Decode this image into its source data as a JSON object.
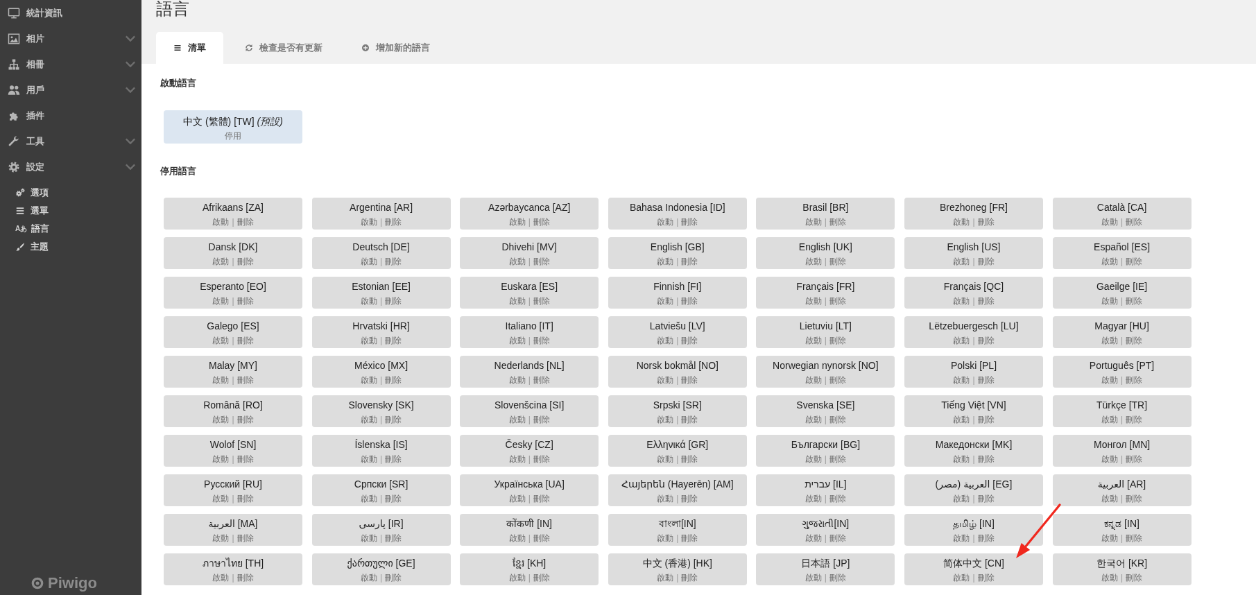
{
  "sidebar": {
    "items": [
      {
        "label": "統計資訊",
        "expandable": false
      },
      {
        "label": "相片",
        "expandable": true
      },
      {
        "label": "相冊",
        "expandable": true
      },
      {
        "label": "用戶",
        "expandable": true
      },
      {
        "label": "插件",
        "expandable": false
      },
      {
        "label": "工具",
        "expandable": true
      },
      {
        "label": "設定",
        "expandable": true,
        "children": [
          {
            "label": "選項"
          },
          {
            "label": "選單"
          },
          {
            "label": "語言",
            "glyph": "Aあ"
          },
          {
            "label": "主題"
          }
        ]
      }
    ],
    "logo": "Piwigo"
  },
  "page_title": "語言",
  "tabs": [
    {
      "label": "清單",
      "selected": true
    },
    {
      "label": "檢查是否有更新",
      "selected": false
    },
    {
      "label": "增加新的語言",
      "selected": false
    }
  ],
  "enabled_section": {
    "heading": "啟動語言",
    "languages": [
      {
        "name": "中文 (繁體) [TW] *(預設)*",
        "actions": [
          "停用"
        ]
      }
    ]
  },
  "disabled_section": {
    "heading": "停用語言",
    "languages": [
      {
        "name": "Afrikaans [ZA]",
        "actions": [
          "啟動",
          "刪除"
        ],
        "separator": "|"
      },
      {
        "name": "Argentina [AR]",
        "actions": [
          "啟動",
          "刪除"
        ],
        "separator": "|"
      },
      {
        "name": "Azərbaycanca [AZ]",
        "actions": [
          "啟動",
          "刪除"
        ],
        "separator": "|"
      },
      {
        "name": "Bahasa Indonesia [ID]",
        "actions": [
          "啟動",
          "刪除"
        ],
        "separator": "|"
      },
      {
        "name": "Brasil [BR]",
        "actions": [
          "啟動",
          "刪除"
        ],
        "separator": "|"
      },
      {
        "name": "Brezhoneg [FR]",
        "actions": [
          "啟動",
          "刪除"
        ],
        "separator": "|"
      },
      {
        "name": "Català [CA]",
        "actions": [
          "啟動",
          "刪除"
        ],
        "separator": "|"
      },
      {
        "name": "Dansk [DK]",
        "actions": [
          "啟動",
          "刪除"
        ],
        "separator": "|"
      },
      {
        "name": "Deutsch [DE]",
        "actions": [
          "啟動",
          "刪除"
        ],
        "separator": "|"
      },
      {
        "name": "Dhivehi [MV]",
        "actions": [
          "啟動",
          "刪除"
        ],
        "separator": "|"
      },
      {
        "name": "English [GB]",
        "actions": [
          "啟動",
          "刪除"
        ],
        "separator": "|"
      },
      {
        "name": "English [UK]",
        "actions": [
          "啟動",
          "刪除"
        ],
        "separator": "|"
      },
      {
        "name": "English [US]",
        "actions": [
          "啟動",
          "刪除"
        ],
        "separator": "|"
      },
      {
        "name": "Español [ES]",
        "actions": [
          "啟動",
          "刪除"
        ],
        "separator": "|"
      },
      {
        "name": "Esperanto [EO]",
        "actions": [
          "啟動",
          "刪除"
        ],
        "separator": "|"
      },
      {
        "name": "Estonian [EE]",
        "actions": [
          "啟動",
          "刪除"
        ],
        "separator": "|"
      },
      {
        "name": "Euskara [ES]",
        "actions": [
          "啟動",
          "刪除"
        ],
        "separator": "|"
      },
      {
        "name": "Finnish [FI]",
        "actions": [
          "啟動",
          "刪除"
        ],
        "separator": "|"
      },
      {
        "name": "Français [FR]",
        "actions": [
          "啟動",
          "刪除"
        ],
        "separator": "|"
      },
      {
        "name": "Français [QC]",
        "actions": [
          "啟動",
          "刪除"
        ],
        "separator": "|"
      },
      {
        "name": "Gaeilge [IE]",
        "actions": [
          "啟動",
          "刪除"
        ],
        "separator": "|"
      },
      {
        "name": "Galego [ES]",
        "actions": [
          "啟動",
          "刪除"
        ],
        "separator": "|"
      },
      {
        "name": "Hrvatski [HR]",
        "actions": [
          "啟動",
          "刪除"
        ],
        "separator": "|"
      },
      {
        "name": "Italiano [IT]",
        "actions": [
          "啟動",
          "刪除"
        ],
        "separator": "|"
      },
      {
        "name": "Latviešu [LV]",
        "actions": [
          "啟動",
          "刪除"
        ],
        "separator": "|"
      },
      {
        "name": "Lietuviu [LT]",
        "actions": [
          "啟動",
          "刪除"
        ],
        "separator": "|"
      },
      {
        "name": "Lëtzebuergesch [LU]",
        "actions": [
          "啟動",
          "刪除"
        ],
        "separator": "|"
      },
      {
        "name": "Magyar [HU]",
        "actions": [
          "啟動",
          "刪除"
        ],
        "separator": "|"
      },
      {
        "name": "Malay [MY]",
        "actions": [
          "啟動",
          "刪除"
        ],
        "separator": "|"
      },
      {
        "name": "México [MX]",
        "actions": [
          "啟動",
          "刪除"
        ],
        "separator": "|"
      },
      {
        "name": "Nederlands [NL]",
        "actions": [
          "啟動",
          "刪除"
        ],
        "separator": "|"
      },
      {
        "name": "Norsk bokmål [NO]",
        "actions": [
          "啟動",
          "刪除"
        ],
        "separator": "|"
      },
      {
        "name": "Norwegian nynorsk [NO]",
        "actions": [
          "啟動",
          "刪除"
        ],
        "separator": "|"
      },
      {
        "name": "Polski [PL]",
        "actions": [
          "啟動",
          "刪除"
        ],
        "separator": "|"
      },
      {
        "name": "Português [PT]",
        "actions": [
          "啟動",
          "刪除"
        ],
        "separator": "|"
      },
      {
        "name": "Română [RO]",
        "actions": [
          "啟動",
          "刪除"
        ],
        "separator": "|"
      },
      {
        "name": "Slovensky [SK]",
        "actions": [
          "啟動",
          "刪除"
        ],
        "separator": "|"
      },
      {
        "name": "Slovenšcina [SI]",
        "actions": [
          "啟動",
          "刪除"
        ],
        "separator": "|"
      },
      {
        "name": "Srpski [SR]",
        "actions": [
          "啟動",
          "刪除"
        ],
        "separator": "|"
      },
      {
        "name": "Svenska [SE]",
        "actions": [
          "啟動",
          "刪除"
        ],
        "separator": "|"
      },
      {
        "name": "Tiếng Việt [VN]",
        "actions": [
          "啟動",
          "刪除"
        ],
        "separator": "|"
      },
      {
        "name": "Türkçe [TR]",
        "actions": [
          "啟動",
          "刪除"
        ],
        "separator": "|"
      },
      {
        "name": "Wolof [SN]",
        "actions": [
          "啟動",
          "刪除"
        ],
        "separator": "|"
      },
      {
        "name": "Íslenska [IS]",
        "actions": [
          "啟動",
          "刪除"
        ],
        "separator": "|"
      },
      {
        "name": "Česky [CZ]",
        "actions": [
          "啟動",
          "刪除"
        ],
        "separator": "|"
      },
      {
        "name": "Ελληνικά [GR]",
        "actions": [
          "啟動",
          "刪除"
        ],
        "separator": "|"
      },
      {
        "name": "Български [BG]",
        "actions": [
          "啟動",
          "刪除"
        ],
        "separator": "|"
      },
      {
        "name": "Македонски [MK]",
        "actions": [
          "啟動",
          "刪除"
        ],
        "separator": "|"
      },
      {
        "name": "Монгол [MN]",
        "actions": [
          "啟動",
          "刪除"
        ],
        "separator": "|"
      },
      {
        "name": "Русский [RU]",
        "actions": [
          "啟動",
          "刪除"
        ],
        "separator": "|"
      },
      {
        "name": "Српски [SR]",
        "actions": [
          "啟動",
          "刪除"
        ],
        "separator": "|"
      },
      {
        "name": "Українська [UA]",
        "actions": [
          "啟動",
          "刪除"
        ],
        "separator": "|"
      },
      {
        "name": "Հայերեն (Hayerēn) [AM]",
        "actions": [
          "啟動",
          "刪除"
        ],
        "separator": "|"
      },
      {
        "name": "עברית [IL]",
        "actions": [
          "啟動",
          "刪除"
        ],
        "separator": "|"
      },
      {
        "name": "العربية (مصر) [EG]",
        "actions": [
          "啟動",
          "刪除"
        ],
        "separator": "|"
      },
      {
        "name": "العربية [AR]",
        "actions": [
          "啟動",
          "刪除"
        ],
        "separator": "|"
      },
      {
        "name": "العربية [MA]",
        "actions": [
          "啟動",
          "刪除"
        ],
        "separator": "|"
      },
      {
        "name": "پارسی [IR]",
        "actions": [
          "啟動",
          "刪除"
        ],
        "separator": "|"
      },
      {
        "name": "कोंकणी [IN]",
        "actions": [
          "啟動",
          "刪除"
        ],
        "separator": "|"
      },
      {
        "name": "বাংলা[IN]",
        "actions": [
          "啟動",
          "刪除"
        ],
        "separator": "|"
      },
      {
        "name": "ગુજરાતી[IN]",
        "actions": [
          "啟動",
          "刪除"
        ],
        "separator": "|"
      },
      {
        "name": "தமிழ் [IN]",
        "actions": [
          "啟動",
          "刪除"
        ],
        "separator": "|"
      },
      {
        "name": "ಕನ್ನಡ [IN]",
        "actions": [
          "啟動",
          "刪除"
        ],
        "separator": "|"
      },
      {
        "name": "ภาษาไทย [TH]",
        "actions": [
          "啟動",
          "刪除"
        ],
        "separator": "|"
      },
      {
        "name": "ქართული [GE]",
        "actions": [
          "啟動",
          "刪除"
        ],
        "separator": "|"
      },
      {
        "name": "ខ្មែរ [KH]",
        "actions": [
          "啟動",
          "刪除"
        ],
        "separator": "|"
      },
      {
        "name": "中文 (香港) [HK]",
        "actions": [
          "啟動",
          "刪除"
        ],
        "separator": "|"
      },
      {
        "name": "日本語 [JP]",
        "actions": [
          "啟動",
          "刪除"
        ],
        "separator": "|"
      },
      {
        "name": "简体中文 [CN]",
        "actions": [
          "啟動",
          "刪除"
        ],
        "separator": "|"
      },
      {
        "name": "한국어 [KR]",
        "actions": [
          "啟動",
          "刪除"
        ],
        "separator": "|"
      }
    ]
  }
}
